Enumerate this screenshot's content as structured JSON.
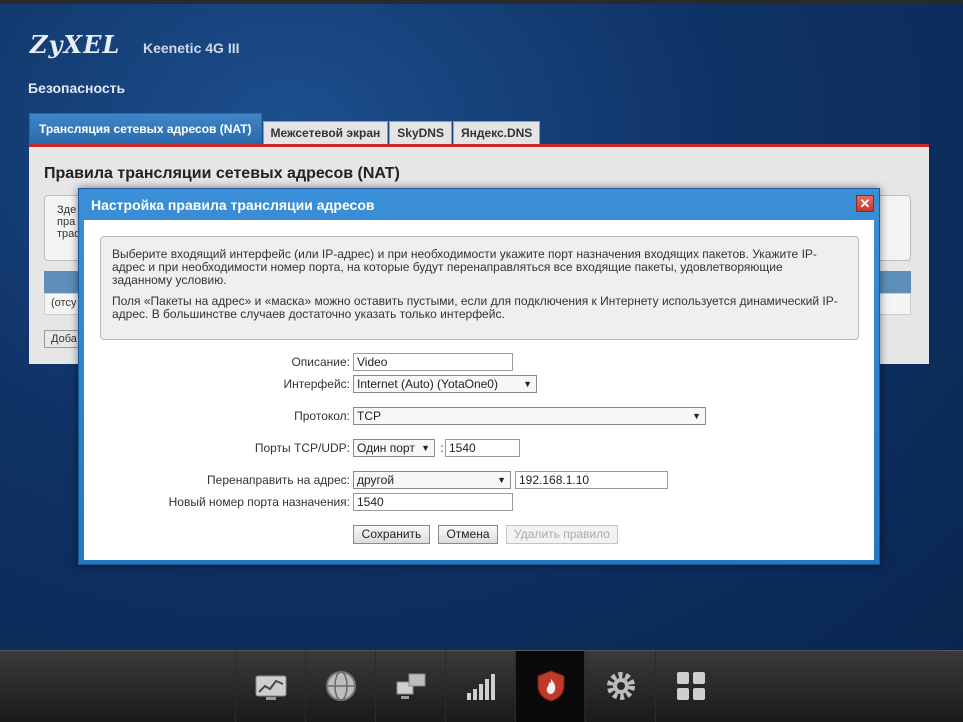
{
  "header": {
    "logo": "ZyXEL",
    "model": "Keenetic 4G III",
    "section": "Безопасность"
  },
  "tabs": [
    {
      "label": "Трансляция сетевых адресов (NAT)",
      "active": true
    },
    {
      "label": "Межсетевой экран",
      "active": false
    },
    {
      "label": "SkyDNS",
      "active": false
    },
    {
      "label": "Яндекс.DNS",
      "active": false
    }
  ],
  "panel": {
    "title": "Правила трансляции сетевых адресов (NAT)",
    "info_fragments": [
      "Зде",
      "пра",
      "траф"
    ],
    "row_fragment": "(отсу",
    "add_fragment": "Доба"
  },
  "dialog": {
    "title": "Настройка правила трансляции адресов",
    "close_label": "✕",
    "hint_p1": "Выберите входящий интерфейс (или IP-адрес) и при необходимости укажите порт назначения входящих пакетов. Укажите IP-адрес и при необходимости номер порта, на которые будут перенаправляться все входящие пакеты, удовлетворяющие заданному условию.",
    "hint_p2": "Поля «Пакеты на адрес» и «маска» можно оставить пустыми, если для подключения к Интернету используется динамический IP-адрес. В большинстве случаев достаточно указать только интерфейс.",
    "form": {
      "description_label": "Описание:",
      "description_value": "Video",
      "interface_label": "Интерфейс:",
      "interface_value": "Internet (Auto) (YotaOne0)",
      "protocol_label": "Протокол:",
      "protocol_value": "TCP",
      "ports_label": "Порты TCP/UDP:",
      "ports_mode": "Один порт",
      "ports_sep": ":",
      "ports_value": "1540",
      "redirect_label": "Перенаправить на адрес:",
      "redirect_mode": "другой",
      "redirect_ip": "192.168.1.10",
      "newport_label": "Новый номер порта назначения:",
      "newport_value": "1540"
    },
    "buttons": {
      "save": "Сохранить",
      "cancel": "Отмена",
      "delete": "Удалить правило"
    }
  },
  "bottom_nav": [
    {
      "icon": "monitor-chart-icon",
      "active": false
    },
    {
      "icon": "globe-icon",
      "active": false
    },
    {
      "icon": "network-computers-icon",
      "active": false
    },
    {
      "icon": "signal-bars-icon",
      "active": false
    },
    {
      "icon": "shield-fire-icon",
      "active": true
    },
    {
      "icon": "gear-icon",
      "active": false
    },
    {
      "icon": "apps-grid-icon",
      "active": false
    }
  ],
  "colors": {
    "accent_blue": "#2677c2",
    "tab_active": "#3f86c8",
    "panel_red_line": "#c8282a",
    "close_red": "#d0402e"
  }
}
